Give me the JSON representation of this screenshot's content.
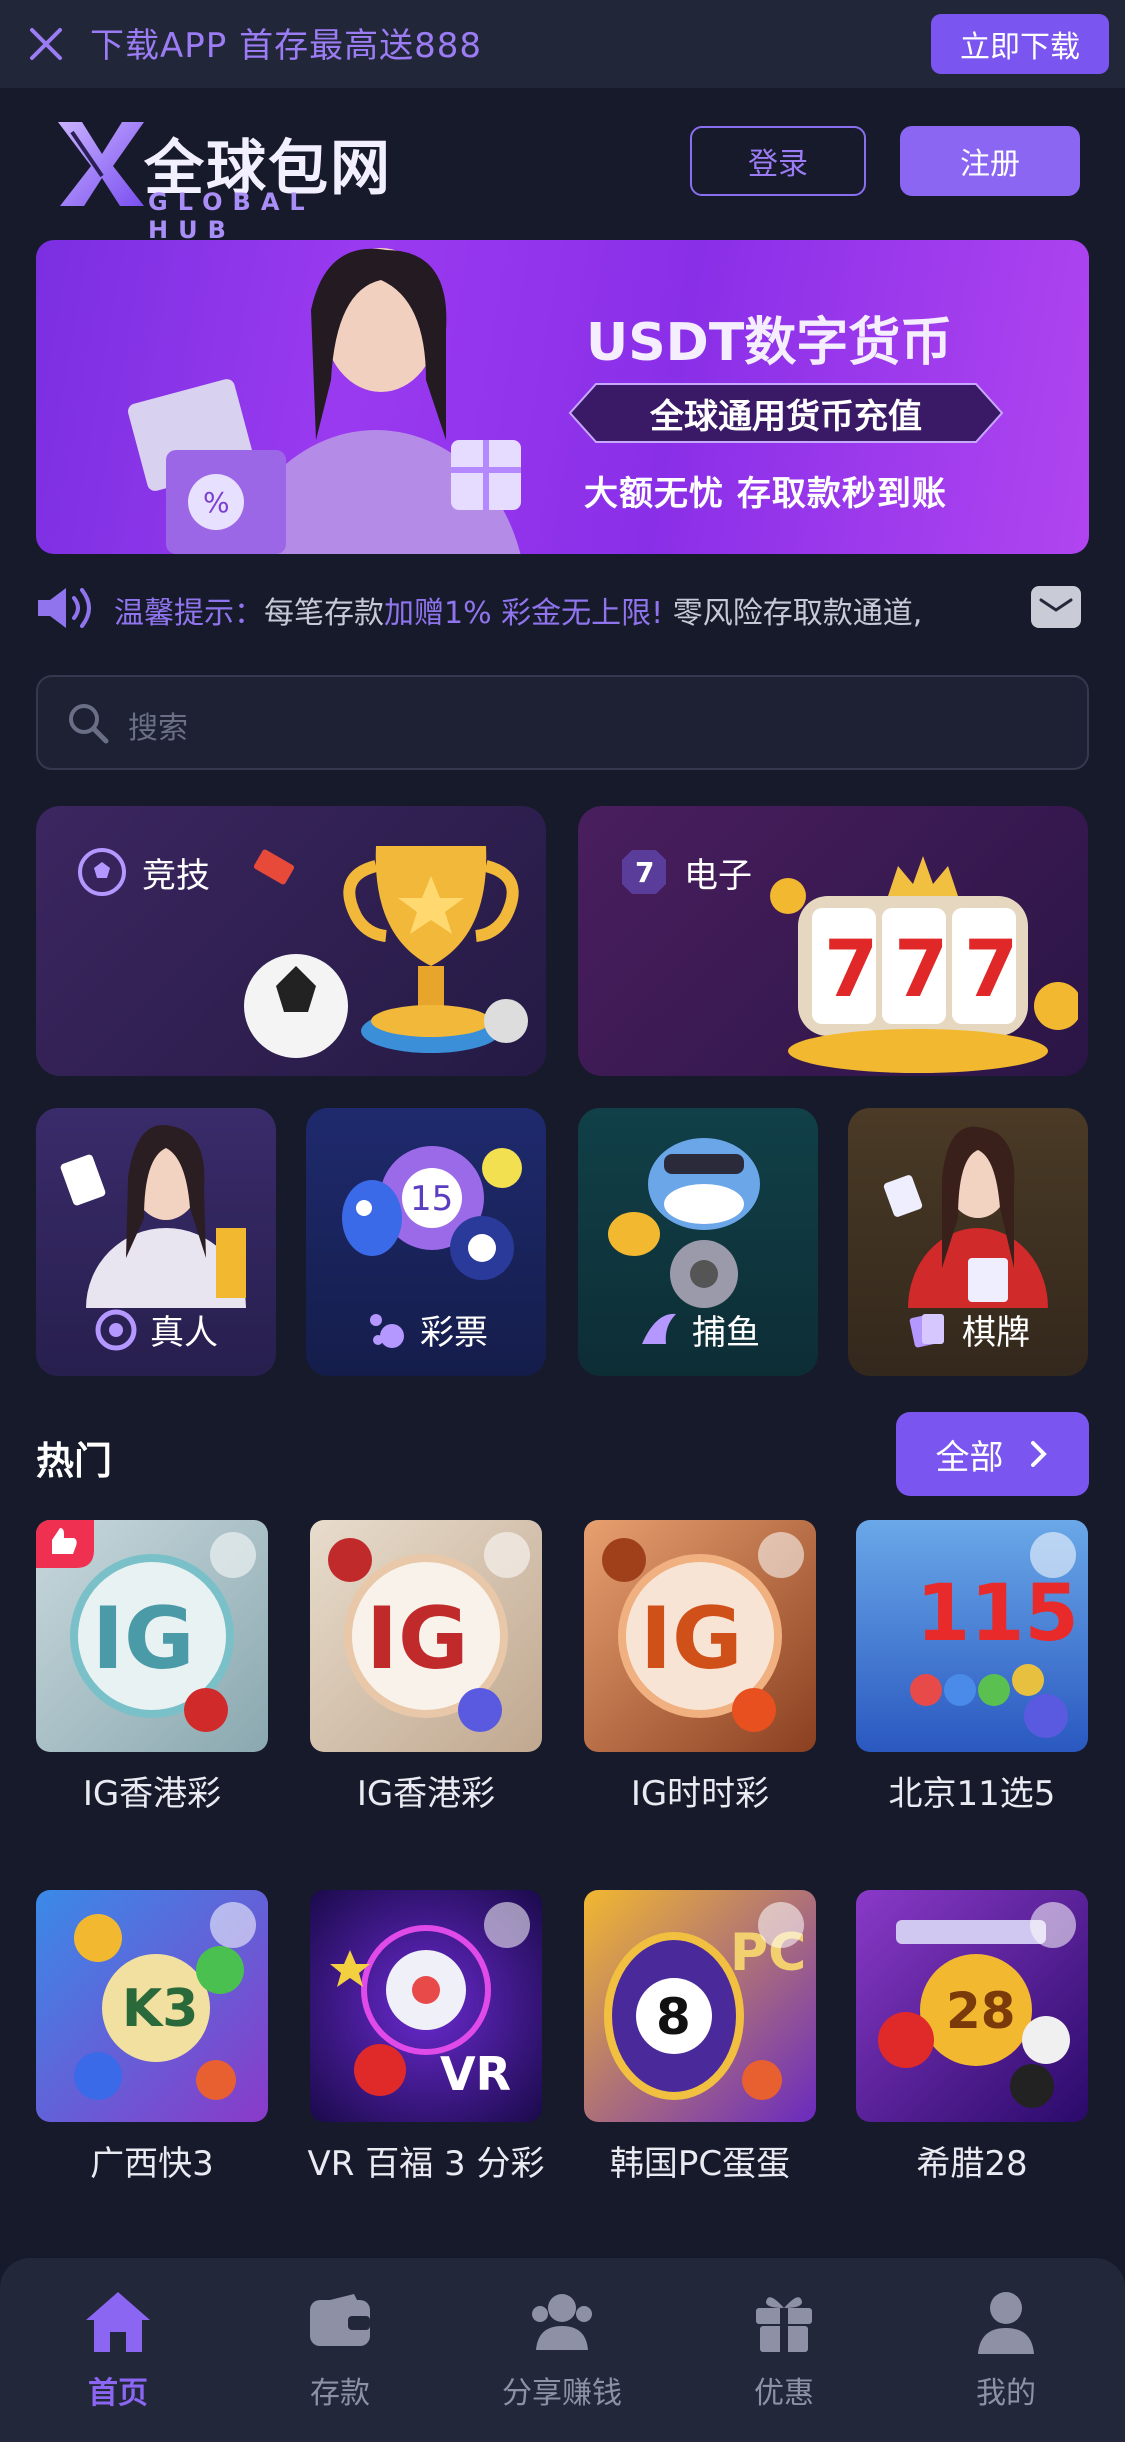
{
  "topbar": {
    "promo": "下载APP 首存最高送888",
    "download_label": "立即下载"
  },
  "header": {
    "logo_cn": "全球包网",
    "logo_en": "GLOBAL HUB",
    "login_label": "登录",
    "register_label": "注册"
  },
  "banner": {
    "title": "USDT数字货币",
    "subtitle": "全球通用货币充值",
    "tagline": "大额无忧 存取款秒到账"
  },
  "notice": {
    "label": "温馨提示：",
    "text_a": "每笔存款",
    "text_b": "加赠1% 彩金无上限!",
    "text_c": " 零风险存取款通道,"
  },
  "search": {
    "placeholder": "搜索"
  },
  "categories_big": [
    {
      "label": "竞技"
    },
    {
      "label": "电子"
    }
  ],
  "categories_small": [
    {
      "label": "真人"
    },
    {
      "label": "彩票"
    },
    {
      "label": "捕鱼"
    },
    {
      "label": "棋牌"
    }
  ],
  "hot": {
    "title": "热门",
    "all_label": "全部"
  },
  "games": [
    {
      "name": "IG香港彩"
    },
    {
      "name": "IG香港彩"
    },
    {
      "name": "IG时时彩"
    },
    {
      "name": "北京11选5"
    },
    {
      "name": "广西快3"
    },
    {
      "name": "VR 百福 3 分彩"
    },
    {
      "name": "韩国PC蛋蛋"
    },
    {
      "name": "希腊28"
    }
  ],
  "game_thumbs": {
    "ig": "IG",
    "bj": "115",
    "k3": "K3",
    "vr": "VR",
    "pc": "PC",
    "g28": "28"
  },
  "nav": [
    {
      "label": "首页"
    },
    {
      "label": "存款"
    },
    {
      "label": "分享赚钱"
    },
    {
      "label": "优惠"
    },
    {
      "label": "我的"
    }
  ],
  "colors": {
    "accent": "#7a55f0",
    "bg": "#171a2a",
    "nav_active": "#8a66f2"
  }
}
